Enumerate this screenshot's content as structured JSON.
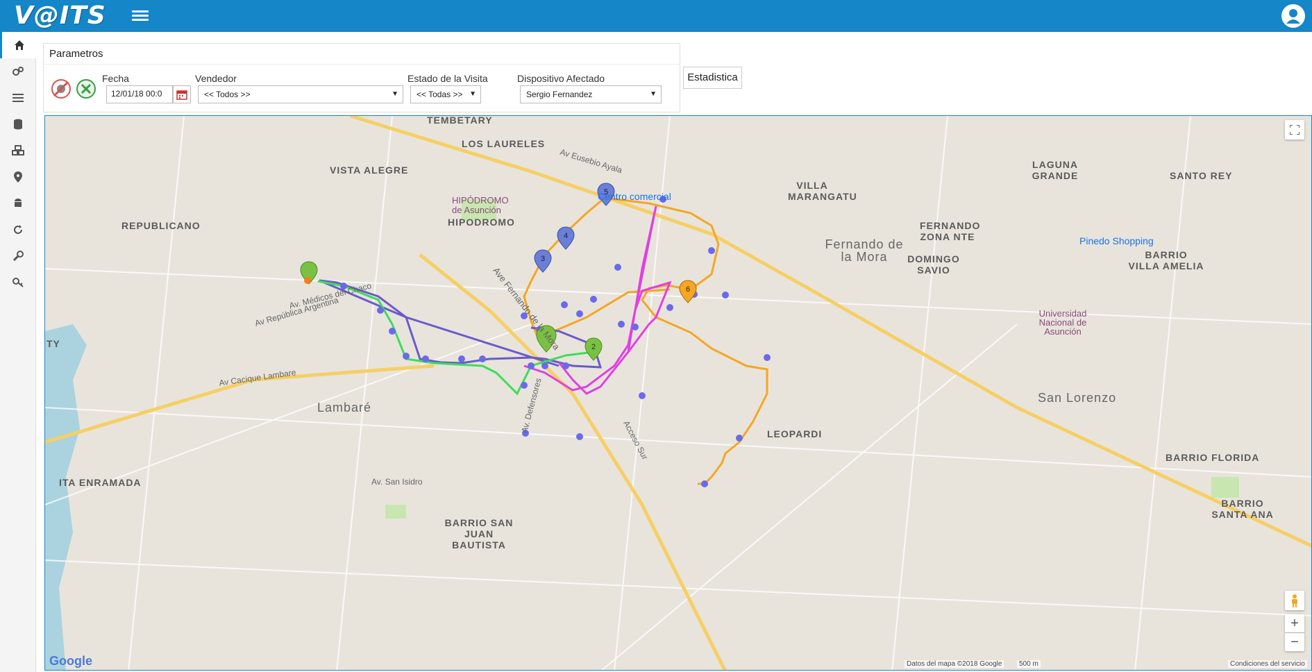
{
  "app": {
    "logo": "V@ITS"
  },
  "sidebar": {
    "items": [
      {
        "icon": "home-icon"
      },
      {
        "icon": "gears-icon"
      },
      {
        "icon": "list-icon"
      },
      {
        "icon": "database-icon"
      },
      {
        "icon": "cubes-icon"
      },
      {
        "icon": "map-marker-icon"
      },
      {
        "icon": "android-icon"
      },
      {
        "icon": "refresh-icon"
      },
      {
        "icon": "wrench-icon"
      },
      {
        "icon": "key-icon"
      }
    ]
  },
  "params": {
    "title": "Parametros",
    "fecha_label": "Fecha",
    "fecha_value": "12/01/18 00:0",
    "vendedor_label": "Vendedor",
    "vendedor_value": "<< Todos >>",
    "estado_label": "Estado de la Visita",
    "estado_value": "<< Todas >>",
    "dispositivo_label": "Dispositivo Afectado",
    "dispositivo_value": "Sergio Fernandez",
    "stats_button": "Estadistica"
  },
  "map": {
    "labels": {
      "tembetary": "TEMBETARY",
      "los_laureles": "LOS LAURELES",
      "vista_alegre": "VISTA ALEGRE",
      "republicano": "REPUBLICANO",
      "hipodromo_poi": "HIPÓDROMO de Asunción",
      "hipodromo": "HIPODROMO",
      "centro_comercial": "Centro comercial",
      "villa_marangatu": "VILLA MARANGATU",
      "laguna_grande": "LAGUNA GRANDE",
      "santo_rey": "SANTO REY",
      "fernando_zona_nte": "FERNANDO ZONA NTE",
      "pinedo_shopping": "Pinedo Shopping",
      "barrio_villa_amelia": "BARRIO VILLA AMELIA",
      "fernando_de_la_mora": "Fernando de la Mora",
      "domingo_savio": "DOMINGO SAVIO",
      "universidad": "Universidad Nacional de Asunción",
      "san_lorenzo": "San Lorenzo",
      "lambare": "Lambaré",
      "leopardi": "LEOPARDI",
      "barrio_florida": "BARRIO FLORIDA",
      "ita_enramada": "ITA ENRAMADA",
      "barrio_san_juan": "BARRIO SAN JUAN BAUTISTA",
      "barrio_santa_ana": "BARRIO SANTA ANA",
      "av_eusebio_ayala": "Av Eusebio Ayala",
      "ave_fernando_de_la_mora": "Ave Fernando de la Mora",
      "acceso_sur": "Acceso Sur",
      "av_cacique_lambare": "Av Cacique Lambare",
      "av_republica_argentina": "Av República Argentina",
      "av_medicos_chaco": "Av. Médicos del Chaco",
      "av_san_isidro": "Av. San Isidro",
      "av_defensores": "Av. Defensores",
      "ty": "TY"
    },
    "markers": [
      "5",
      "4",
      "3",
      "6",
      "2"
    ],
    "footer": {
      "google": "Google",
      "data": "Datos del mapa ©2018 Google",
      "scale": "500 m",
      "terms": "Condiciones del servicio"
    },
    "colors": {
      "route_orange": "#f5a623",
      "route_purple": "#6a5acd",
      "route_green": "#3ddc5a",
      "route_magenta": "#e040e0"
    }
  }
}
